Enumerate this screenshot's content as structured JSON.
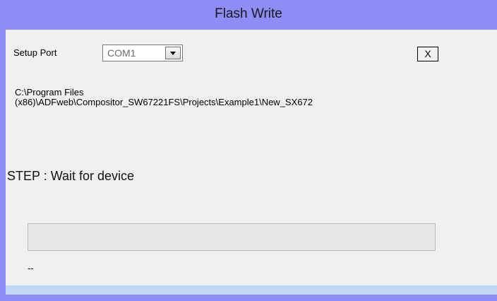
{
  "window": {
    "title": "Flash Write"
  },
  "port": {
    "label": "Setup Port",
    "selected": "COM1"
  },
  "close_button": {
    "label": "X"
  },
  "path": "C:\\Program Files\n(x86)\\ADFweb\\Compositor_SW67221FS\\Projects\\Example1\\New_SX672",
  "step_text": "STEP : Wait for device",
  "progress": {
    "value": 0
  },
  "status_text": "--"
}
